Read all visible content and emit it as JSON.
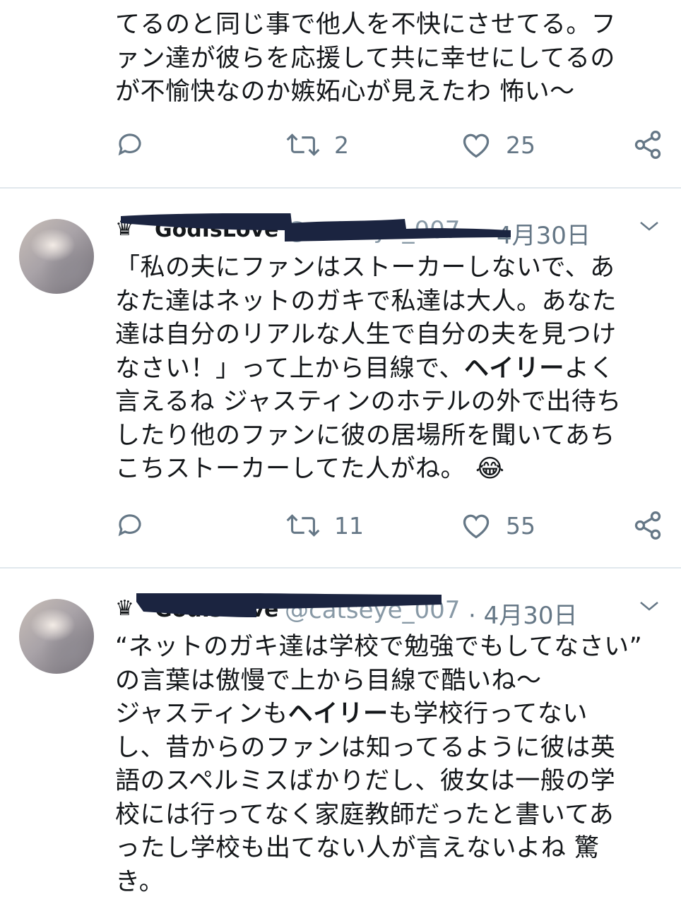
{
  "tweets": [
    {
      "text_lines": [
        "てるのと同じ事で他人を不快にさせてる。フ",
        "ァン達が彼らを応援して共に幸せにしてるの",
        "が不愉快なのか嫉妬心が見えたわ 怖い〜"
      ],
      "retweets": "2",
      "likes": "25"
    },
    {
      "display_name": "GodIsLove",
      "handle": "@catseye_007",
      "date": "4月30日",
      "text_before": "「私の夫にファンはストーカーしないで、あ\nなた達はネットのガキで私達は大人。あなた\n達は自分のリアルな人生で自分の夫を見つけ\nなさい！」って上から目線で、",
      "text_bold": "ヘイリー",
      "text_after": "よく\n言えるね ジャスティンのホテルの外で出待ち\nしたり他のファンに彼の居場所を聞いてあち\nこちストーカーしてた人がね。",
      "emoji": "😂",
      "retweets": "11",
      "likes": "55"
    },
    {
      "display_name": "GodIsLove",
      "handle": "@catseye_007",
      "date": "· 4月30日",
      "text_before": "“ネットのガキ達は学校で勉強でもしてなさい”\nの言葉は傲慢で上から目線で酷いね〜\nジャスティンも",
      "text_bold": "ヘイリー",
      "text_after": "も学校行ってない\nし、昔からのファンは知ってるように彼は英\n語のスペルミスばかりだし、彼女は一般の学\n校には行ってなく家庭教師だったと書いてあ\nったし学校も出てない人が言えないよね 驚\nき。"
    }
  ],
  "icons": {
    "crown": "♛",
    "reply": "reply-icon",
    "retweet": "retweet-icon",
    "like": "heart-icon",
    "share": "share-icon"
  },
  "colors": {
    "text": "#14171a",
    "muted": "#657786",
    "divider": "#e1e8ed",
    "redaction": "#1b2440"
  }
}
